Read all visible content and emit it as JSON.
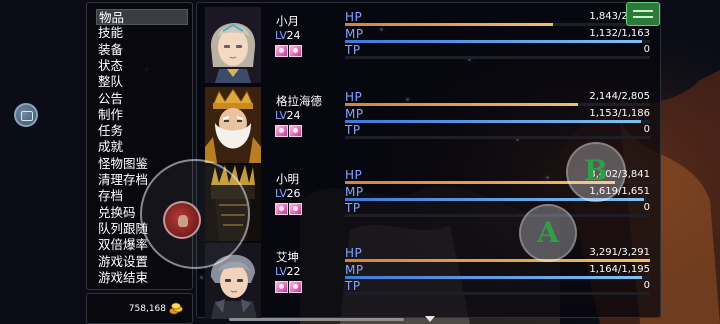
{
  "menu": {
    "items": [
      {
        "label": "物品",
        "selected": true
      },
      {
        "label": "技能"
      },
      {
        "label": "装备"
      },
      {
        "label": "状态"
      },
      {
        "label": "整队"
      },
      {
        "label": "公告"
      },
      {
        "label": "制作"
      },
      {
        "label": "任务"
      },
      {
        "label": "成就"
      },
      {
        "label": "怪物图鉴"
      },
      {
        "label": "清理存档"
      },
      {
        "label": "存档"
      },
      {
        "label": "兑换码"
      },
      {
        "label": "队列跟随"
      },
      {
        "label": "双倍爆率"
      },
      {
        "label": "游戏设置"
      },
      {
        "label": "游戏结束"
      }
    ]
  },
  "gold": {
    "value": "758,168",
    "icon": "gold-coins-icon"
  },
  "status": {
    "gauge_labels": {
      "hp": "HP",
      "mp": "MP",
      "tp": "TP"
    },
    "level_label": "LV",
    "actors": [
      {
        "name": "小月",
        "level": "24",
        "hp": "1,843/2,705",
        "mp": "1,132/1,163",
        "tp": "0",
        "hp_ratio": 0.681,
        "mp_ratio": 0.973,
        "tp_ratio": 0,
        "state_icons": [
          "buff-icon",
          "buff-icon"
        ]
      },
      {
        "name": "格拉海德",
        "level": "24",
        "hp": "2,144/2,805",
        "mp": "1,153/1,186",
        "tp": "0",
        "hp_ratio": 0.764,
        "mp_ratio": 0.972,
        "tp_ratio": 0,
        "state_icons": [
          "buff-icon",
          "buff-icon"
        ]
      },
      {
        "name": "小明",
        "level": "26",
        "hp": "3,402/3,841",
        "mp": "1,619/1,651",
        "tp": "0",
        "hp_ratio": 0.886,
        "mp_ratio": 0.981,
        "tp_ratio": 0,
        "state_icons": [
          "buff-icon",
          "buff-icon"
        ]
      },
      {
        "name": "艾坤",
        "level": "22",
        "hp": "3,291/3,291",
        "mp": "1,164/1,195",
        "tp": "0",
        "hp_ratio": 1.0,
        "mp_ratio": 0.974,
        "tp_ratio": 0,
        "state_icons": [
          "buff-icon",
          "buff-icon"
        ]
      }
    ]
  },
  "controls": {
    "button_a": "A",
    "button_b": "B"
  },
  "colors": {
    "system_blue": "#84a4ff",
    "hp_gauge": "#f0c15c",
    "mp_gauge": "#7cc1f5",
    "action_letter": "#2fa046"
  }
}
